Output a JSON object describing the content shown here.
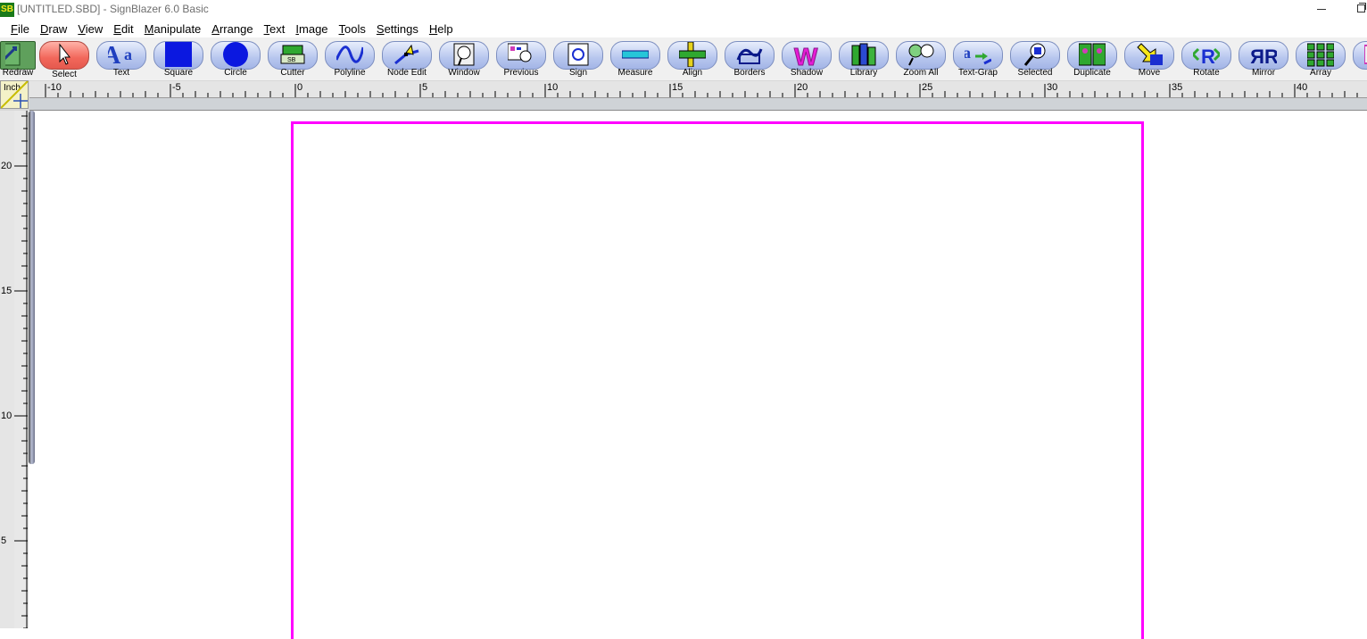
{
  "window": {
    "title": "[UNTITLED.SBD] - SignBlazer 6.0 Basic",
    "logo_text": "SB"
  },
  "menu": [
    {
      "label": "File",
      "key": "F",
      "rest": "ile"
    },
    {
      "label": "Draw",
      "key": "D",
      "rest": "raw"
    },
    {
      "label": "View",
      "key": "V",
      "rest": "iew"
    },
    {
      "label": "Edit",
      "key": "E",
      "rest": "dit"
    },
    {
      "label": "Manipulate",
      "key": "M",
      "rest": "anipulate"
    },
    {
      "label": "Arrange",
      "key": "A",
      "rest": "rrange"
    },
    {
      "label": "Text",
      "key": "T",
      "rest": "ext"
    },
    {
      "label": "Image",
      "key": "I",
      "rest": "mage"
    },
    {
      "label": "Tools",
      "key": "T",
      "rest": "ools"
    },
    {
      "label": "Settings",
      "key": "S",
      "rest": "ettings"
    },
    {
      "label": "Help",
      "key": "H",
      "rest": "elp"
    }
  ],
  "toolbar": [
    {
      "label": "Redraw",
      "icon": "redraw-icon"
    },
    {
      "label": "Select",
      "icon": "arrow-cursor-icon",
      "active": true
    },
    {
      "label": "Text",
      "icon": "text-aa-icon"
    },
    {
      "label": "Square",
      "icon": "square-icon"
    },
    {
      "label": "Circle",
      "icon": "circle-icon"
    },
    {
      "label": "Cutter",
      "icon": "cutter-icon"
    },
    {
      "label": "Polyline",
      "icon": "polyline-icon"
    },
    {
      "label": "Node Edit",
      "icon": "node-edit-icon"
    },
    {
      "label": "Window",
      "icon": "window-zoom-icon"
    },
    {
      "label": "Previous",
      "icon": "previous-view-icon"
    },
    {
      "label": "Sign",
      "icon": "sign-icon"
    },
    {
      "label": "Measure",
      "icon": "measure-icon"
    },
    {
      "label": "Align",
      "icon": "align-icon"
    },
    {
      "label": "Borders",
      "icon": "borders-icon"
    },
    {
      "label": "Shadow",
      "icon": "shadow-icon"
    },
    {
      "label": "Library",
      "icon": "library-icon"
    },
    {
      "label": "Zoom All",
      "icon": "zoom-all-icon"
    },
    {
      "label": "Text-Grap",
      "icon": "text-to-graphic-icon"
    },
    {
      "label": "Selected",
      "icon": "zoom-selected-icon"
    },
    {
      "label": "Duplicate",
      "icon": "duplicate-icon"
    },
    {
      "label": "Move",
      "icon": "move-icon"
    },
    {
      "label": "Rotate",
      "icon": "rotate-icon"
    },
    {
      "label": "Mirror",
      "icon": "mirror-icon"
    },
    {
      "label": "Array",
      "icon": "array-icon"
    },
    {
      "label": "",
      "icon": "more-tools-icon"
    }
  ],
  "ruler": {
    "unit": "Inch",
    "horizontal_labels": [
      "-10",
      "-5",
      "0",
      "5",
      "10",
      "15",
      "20",
      "25",
      "30",
      "35",
      "40"
    ],
    "vertical_labels": [
      "20",
      "15",
      "10",
      "5"
    ]
  },
  "colors": {
    "page_border": "#ff00ff",
    "active_tool": "#f2675b",
    "tool_button": "#b7c6ee"
  }
}
